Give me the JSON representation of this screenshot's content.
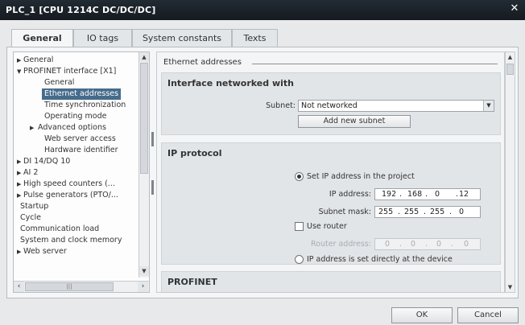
{
  "window": {
    "title": "PLC_1 [CPU 1214C DC/DC/DC]",
    "close_glyph": "✕"
  },
  "tabs": [
    {
      "label": "General",
      "active": true
    },
    {
      "label": "IO tags",
      "active": false
    },
    {
      "label": "System constants",
      "active": false
    },
    {
      "label": "Texts",
      "active": false
    }
  ],
  "nav": {
    "items": [
      {
        "label": "General",
        "expand": "collapsed",
        "level": 0
      },
      {
        "label": "PROFINET interface [X1]",
        "expand": "expanded",
        "level": 0
      },
      {
        "label": "General",
        "expand": "none",
        "level": 1
      },
      {
        "label": "Ethernet addresses",
        "expand": "none",
        "level": 1,
        "selected": true
      },
      {
        "label": "Time synchronization",
        "expand": "none",
        "level": 1
      },
      {
        "label": "Operating mode",
        "expand": "none",
        "level": 1
      },
      {
        "label": "Advanced options",
        "expand": "collapsed",
        "level": 1
      },
      {
        "label": "Web server access",
        "expand": "none",
        "level": 1
      },
      {
        "label": "Hardware identifier",
        "expand": "none",
        "level": 1
      },
      {
        "label": "DI 14/DQ 10",
        "expand": "collapsed",
        "level": 0
      },
      {
        "label": "AI 2",
        "expand": "collapsed",
        "level": 0
      },
      {
        "label": "High speed counters (...",
        "expand": "collapsed",
        "level": 0
      },
      {
        "label": "Pulse generators (PTO/...",
        "expand": "collapsed",
        "level": 0
      },
      {
        "label": "Startup",
        "expand": "none",
        "level": 0
      },
      {
        "label": "Cycle",
        "expand": "none",
        "level": 0
      },
      {
        "label": "Communication load",
        "expand": "none",
        "level": 0
      },
      {
        "label": "System and clock memory",
        "expand": "none",
        "level": 0
      },
      {
        "label": "Web server",
        "expand": "collapsed",
        "level": 0
      }
    ]
  },
  "main": {
    "section_title": "Ethernet addresses",
    "interface_group": {
      "title": "Interface networked with",
      "subnet_label": "Subnet:",
      "subnet_value": "Not networked",
      "add_subnet_button": "Add new subnet"
    },
    "ip_group": {
      "title": "IP protocol",
      "set_in_project_label": "Set IP address in the project",
      "set_in_project_selected": true,
      "ip_label": "IP address:",
      "ip": [
        "192",
        "168",
        "0",
        "12"
      ],
      "mask_label": "Subnet mask:",
      "mask": [
        "255",
        "255",
        "255",
        "0"
      ],
      "use_router_label": "Use router",
      "use_router_checked": false,
      "router_label": "Router address:",
      "router": [
        "0",
        "0",
        "0",
        "0"
      ],
      "set_at_device_label": "IP address is set directly at the device",
      "set_at_device_selected": false
    },
    "profinet_group": {
      "title": "PROFINET"
    }
  },
  "footer": {
    "ok_label": "OK",
    "cancel_label": "Cancel"
  }
}
